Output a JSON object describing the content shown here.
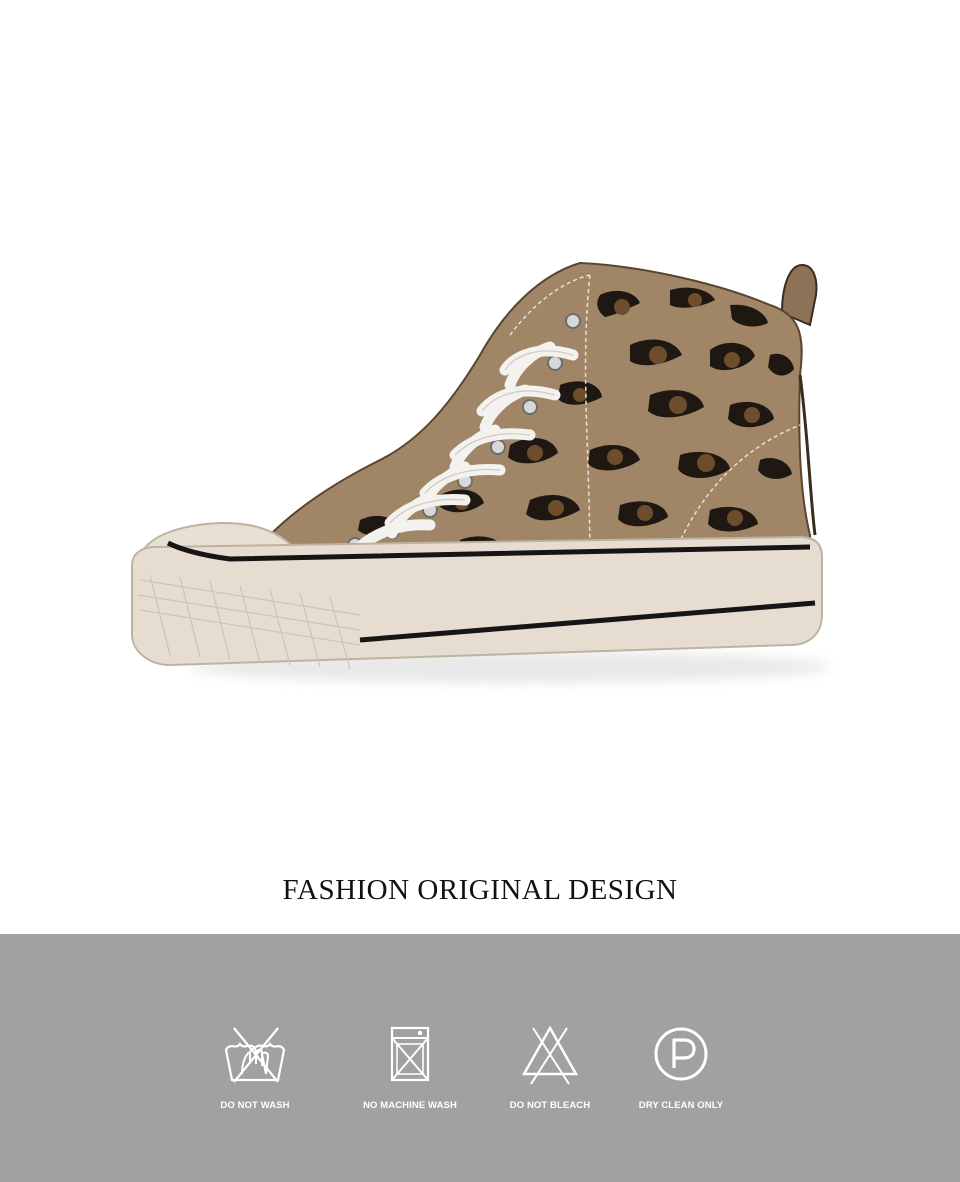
{
  "headline": "FASHION ORIGINAL DESIGN",
  "product_image": {
    "alt": "leopard-print-high-top-sneaker",
    "colors": {
      "canvas": "#a08666",
      "spot_dark": "#1f1812",
      "spot_mid": "#6e4d2c",
      "sole": "#e6ddd0",
      "stripe": "#151515",
      "lace": "#f4f2ee"
    }
  },
  "care_band": {
    "background": "#a1a1a1",
    "items": [
      {
        "label": "DO NOT WASH",
        "icon": "do-not-wash-icon"
      },
      {
        "label": "NO MACHINE WASH",
        "icon": "no-machine-wash-icon"
      },
      {
        "label": "DO NOT BLEACH",
        "icon": "do-not-bleach-icon"
      },
      {
        "label": "DRY CLEAN ONLY",
        "icon": "dry-clean-only-icon"
      }
    ]
  }
}
